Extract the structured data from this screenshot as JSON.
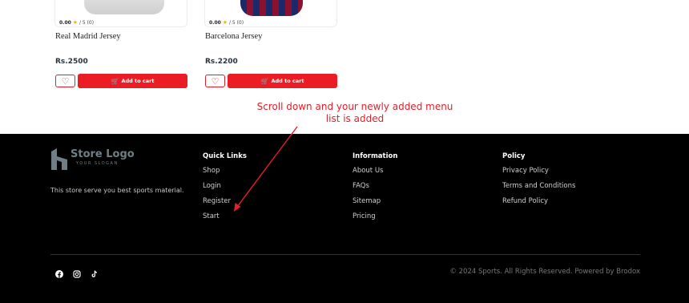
{
  "products": [
    {
      "name": "Real Madrid Jersey",
      "rating": "0.00",
      "rating_suffix": "/ 5 (0)",
      "price": "Rs.2500",
      "cart_label": "Add to cart"
    },
    {
      "name": "Barcelona Jersey",
      "rating": "0.00",
      "rating_suffix": "/ 5 (0)",
      "price": "Rs.2200",
      "cart_label": "Add to cart"
    }
  ],
  "annotation": {
    "line1": "Scroll down and your newly added menu",
    "line2": "list is added",
    "color": "#e0202a"
  },
  "footer": {
    "logo_title": "Store Logo",
    "logo_slogan": "YOUR SLOGAN",
    "about": "This store serve you best sports material.",
    "quick_links": {
      "heading": "Quick Links",
      "items": [
        "Shop",
        "Login",
        "Register",
        "Start"
      ]
    },
    "information": {
      "heading": "Information",
      "items": [
        "About Us",
        "FAQs",
        "Sitemap",
        "Pricing"
      ]
    },
    "policy": {
      "heading": "Policy",
      "items": [
        "Privacy Policy",
        "Terms and Conditions",
        "Refund Policy"
      ]
    },
    "socials": [
      "facebook-icon",
      "instagram-icon",
      "tiktok-icon"
    ],
    "copyright": "© 2024 Sports. All Rights Reserved. Powered by Brodox"
  },
  "colors": {
    "accent": "#ec1c24",
    "footer_bg": "#000000",
    "logo": "#6f7f85"
  }
}
